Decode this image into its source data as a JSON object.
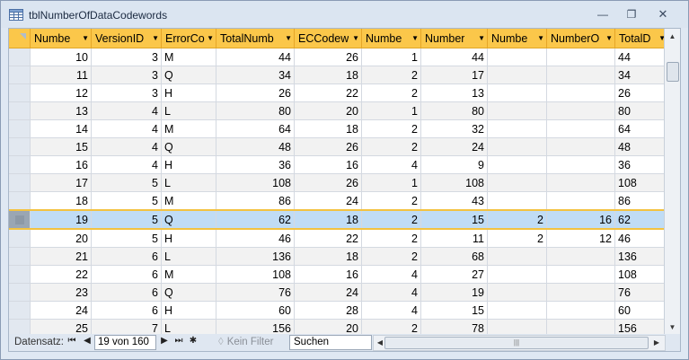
{
  "window": {
    "title": "tblNumberOfDataCodewords",
    "icon": "table-icon"
  },
  "columns": [
    "Numbe",
    "VersionID",
    "ErrorCo",
    "TotalNumb",
    "ECCodew",
    "Numbe",
    "Number",
    "Numbe",
    "NumberO",
    "TotalD"
  ],
  "rows": [
    {
      "cells": [
        "10",
        "3",
        "M",
        "44",
        "26",
        "1",
        "44",
        "",
        "",
        "44"
      ]
    },
    {
      "cells": [
        "11",
        "3",
        "Q",
        "34",
        "18",
        "2",
        "17",
        "",
        "",
        "34"
      ]
    },
    {
      "cells": [
        "12",
        "3",
        "H",
        "26",
        "22",
        "2",
        "13",
        "",
        "",
        "26"
      ]
    },
    {
      "cells": [
        "13",
        "4",
        "L",
        "80",
        "20",
        "1",
        "80",
        "",
        "",
        "80"
      ]
    },
    {
      "cells": [
        "14",
        "4",
        "M",
        "64",
        "18",
        "2",
        "32",
        "",
        "",
        "64"
      ]
    },
    {
      "cells": [
        "15",
        "4",
        "Q",
        "48",
        "26",
        "2",
        "24",
        "",
        "",
        "48"
      ]
    },
    {
      "cells": [
        "16",
        "4",
        "H",
        "36",
        "16",
        "4",
        "9",
        "",
        "",
        "36"
      ]
    },
    {
      "cells": [
        "17",
        "5",
        "L",
        "108",
        "26",
        "1",
        "108",
        "",
        "",
        "108"
      ]
    },
    {
      "cells": [
        "18",
        "5",
        "M",
        "86",
        "24",
        "2",
        "43",
        "",
        "",
        "86"
      ]
    },
    {
      "cells": [
        "19",
        "5",
        "Q",
        "62",
        "18",
        "2",
        "15",
        "2",
        "16",
        "62"
      ],
      "selected": true
    },
    {
      "cells": [
        "20",
        "5",
        "H",
        "46",
        "22",
        "2",
        "11",
        "2",
        "12",
        "46"
      ]
    },
    {
      "cells": [
        "21",
        "6",
        "L",
        "136",
        "18",
        "2",
        "68",
        "",
        "",
        "136"
      ]
    },
    {
      "cells": [
        "22",
        "6",
        "M",
        "108",
        "16",
        "4",
        "27",
        "",
        "",
        "108"
      ]
    },
    {
      "cells": [
        "23",
        "6",
        "Q",
        "76",
        "24",
        "4",
        "19",
        "",
        "",
        "76"
      ]
    },
    {
      "cells": [
        "24",
        "6",
        "H",
        "60",
        "28",
        "4",
        "15",
        "",
        "",
        "60"
      ]
    },
    {
      "cells": [
        "25",
        "7",
        "L",
        "156",
        "20",
        "2",
        "78",
        "",
        "",
        "156"
      ]
    }
  ],
  "navigation": {
    "label": "Datensatz:",
    "record_position": "19 von 160",
    "filter_label": "Kein Filter",
    "search_placeholder": "Suchen"
  },
  "colors": {
    "header_bg": "#fbc74a",
    "selected_row_bg": "#c0dcf5",
    "selected_row_border": "#f3c240"
  }
}
